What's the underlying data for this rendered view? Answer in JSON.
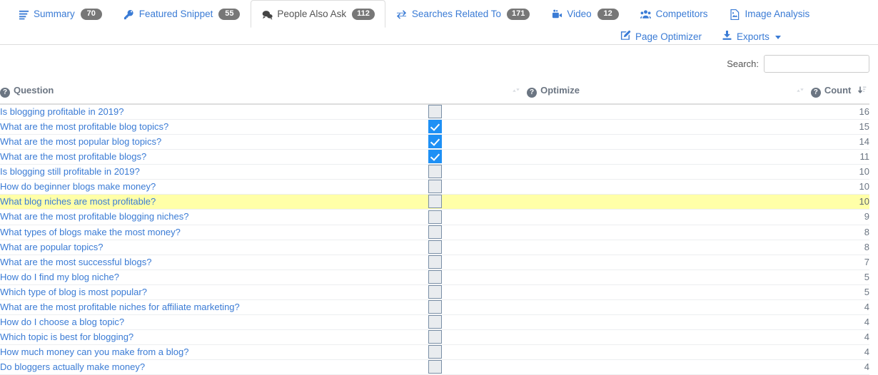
{
  "tabs": {
    "row1": [
      {
        "label": "Summary",
        "badge": "70",
        "icon": "list-bars-icon",
        "active": false
      },
      {
        "label": "Featured Snippet",
        "badge": "55",
        "icon": "key-icon",
        "active": false
      },
      {
        "label": "People Also Ask",
        "badge": "112",
        "icon": "chat-bubbles-icon",
        "active": true
      },
      {
        "label": "Searches Related To",
        "badge": "171",
        "icon": "exchange-arrows-icon",
        "active": false
      },
      {
        "label": "Video",
        "badge": "12",
        "icon": "video-camera-icon",
        "active": false
      },
      {
        "label": "Competitors",
        "badge": "",
        "icon": "users-group-icon",
        "active": false
      },
      {
        "label": "Image Analysis",
        "badge": "",
        "icon": "image-file-icon",
        "active": false
      }
    ],
    "row2": [
      {
        "label": "Page Optimizer",
        "icon": "pencil-square-icon",
        "caret": false
      },
      {
        "label": "Exports",
        "icon": "download-icon",
        "caret": true
      }
    ]
  },
  "search": {
    "label": "Search:",
    "value": "",
    "placeholder": ""
  },
  "table": {
    "headers": {
      "question": "Question",
      "optimize": "Optimize",
      "count": "Count"
    },
    "sort": {
      "question_state": "none",
      "optimize_state": "none",
      "count_state": "desc"
    },
    "rows": [
      {
        "question": "Is blogging profitable in 2019?",
        "checked": false,
        "count": "16",
        "highlighted": false
      },
      {
        "question": "What are the most profitable blog topics?",
        "checked": true,
        "count": "15",
        "highlighted": false
      },
      {
        "question": "What are the most popular blog topics?",
        "checked": true,
        "count": "14",
        "highlighted": false
      },
      {
        "question": "What are the most profitable blogs?",
        "checked": true,
        "count": "11",
        "highlighted": false
      },
      {
        "question": "Is blogging still profitable in 2019?",
        "checked": false,
        "count": "10",
        "highlighted": false
      },
      {
        "question": "How do beginner blogs make money?",
        "checked": false,
        "count": "10",
        "highlighted": false
      },
      {
        "question": "What blog niches are most profitable?",
        "checked": false,
        "count": "10",
        "highlighted": true
      },
      {
        "question": "What are the most profitable blogging niches?",
        "checked": false,
        "count": "9",
        "highlighted": false
      },
      {
        "question": "What types of blogs make the most money?",
        "checked": false,
        "count": "8",
        "highlighted": false
      },
      {
        "question": "What are popular topics?",
        "checked": false,
        "count": "8",
        "highlighted": false
      },
      {
        "question": "What are the most successful blogs?",
        "checked": false,
        "count": "7",
        "highlighted": false
      },
      {
        "question": "How do I find my blog niche?",
        "checked": false,
        "count": "5",
        "highlighted": false
      },
      {
        "question": "Which type of blog is most popular?",
        "checked": false,
        "count": "5",
        "highlighted": false
      },
      {
        "question": "What are the most profitable niches for affiliate marketing?",
        "checked": false,
        "count": "4",
        "highlighted": false
      },
      {
        "question": "How do I choose a blog topic?",
        "checked": false,
        "count": "4",
        "highlighted": false
      },
      {
        "question": "Which topic is best for blogging?",
        "checked": false,
        "count": "4",
        "highlighted": false
      },
      {
        "question": "How much money can you make from a blog?",
        "checked": false,
        "count": "4",
        "highlighted": false
      },
      {
        "question": "Do bloggers actually make money?",
        "checked": false,
        "count": "4",
        "highlighted": false
      }
    ]
  },
  "colors": {
    "link": "#3a7bd5",
    "badge": "#777777",
    "checkbox_checked": "#1e90f5",
    "row_highlight": "#ffffa8",
    "header_text": "#6b7582"
  }
}
